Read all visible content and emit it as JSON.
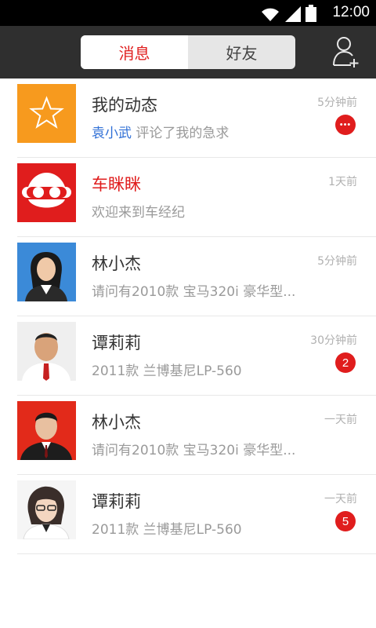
{
  "status_bar": {
    "time": "12:00",
    "icons": [
      "wifi-icon",
      "signal-icon",
      "battery-icon"
    ]
  },
  "header": {
    "tabs": [
      {
        "label": "消息",
        "active": true
      },
      {
        "label": "好友",
        "active": false
      }
    ],
    "add_friend_icon": "add-user-icon"
  },
  "messages": [
    {
      "avatar": "star-avatar",
      "title": "我的动态",
      "highlight": "袁小武",
      "subtitle": " 评论了我的急求",
      "time": "5分钟前",
      "badge": "•••"
    },
    {
      "avatar": "car-logo-avatar",
      "title": "车眯眯",
      "highlight": "",
      "subtitle": "欢迎来到车经纪",
      "time": "1天前",
      "badge": ""
    },
    {
      "avatar": "person-avatar-1",
      "title": "林小杰",
      "highlight": "",
      "subtitle": "请问有2010款 宝马320i 豪华型...",
      "time": "5分钟前",
      "badge": ""
    },
    {
      "avatar": "person-avatar-2",
      "title": "谭莉莉",
      "highlight": "",
      "subtitle": "2011款 兰博基尼LP-560",
      "time": "30分钟前",
      "badge": "2"
    },
    {
      "avatar": "person-avatar-3",
      "title": "林小杰",
      "highlight": "",
      "subtitle": "请问有2010款 宝马320i 豪华型...",
      "time": "一天前",
      "badge": ""
    },
    {
      "avatar": "person-avatar-4",
      "title": "谭莉莉",
      "highlight": "",
      "subtitle": "2011款 兰博基尼LP-560",
      "time": "一天前",
      "badge": "5"
    }
  ],
  "colors": {
    "accent_red": "#e01d1d",
    "highlight_blue": "#2f6fd6",
    "header_bg": "#2f2f2f",
    "star_bg": "#f79a1e"
  }
}
